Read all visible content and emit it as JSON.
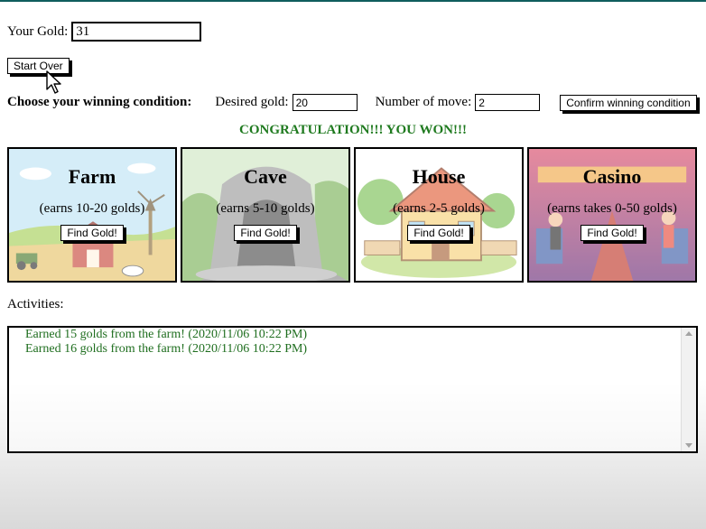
{
  "gold": {
    "label": "Your Gold:",
    "value": "31"
  },
  "start_over_label": "Start Over",
  "winning": {
    "title": "Choose your winning condition:",
    "desired_label": "Desired gold:",
    "desired_value": "20",
    "moves_label": "Number of move:",
    "moves_value": "2",
    "confirm_label": "Confirm winning condition"
  },
  "message": "CONGRATULATION!!! YOU WON!!!",
  "cards": [
    {
      "name": "Farm",
      "earn": "(earns 10-20 golds)",
      "button": "Find Gold!"
    },
    {
      "name": "Cave",
      "earn": "(earns 5-10 golds)",
      "button": "Find Gold!"
    },
    {
      "name": "House",
      "earn": "(earns 2-5 golds)",
      "button": "Find Gold!"
    },
    {
      "name": "Casino",
      "earn": "(earns takes 0-50 golds)",
      "button": "Find Gold!"
    }
  ],
  "activities": {
    "label": "Activities:",
    "entries": [
      "Earned 15 golds from the farm! (2020/11/06 10:22 PM)",
      "Earned 16 golds from the farm! (2020/11/06 10:22 PM)"
    ]
  },
  "colors": {
    "win_text": "#1f7a1f",
    "log_text": "#1f6e1f",
    "top_bar": "#0f5d5d"
  }
}
